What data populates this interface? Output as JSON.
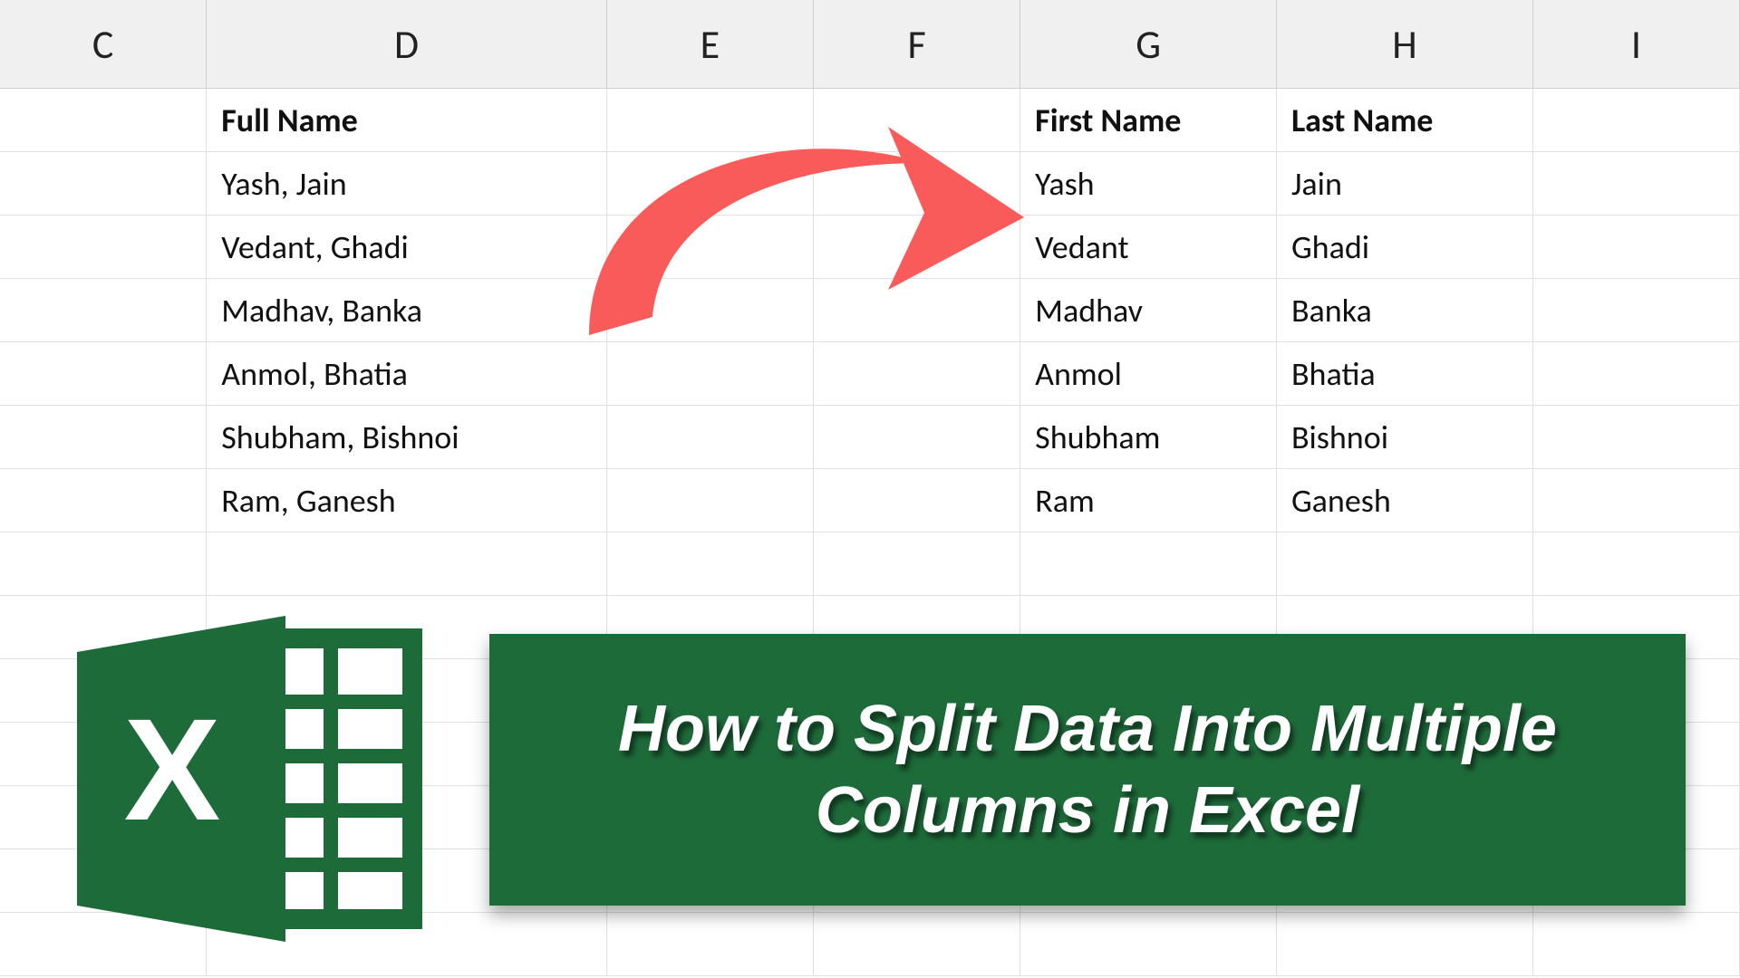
{
  "columns": [
    "C",
    "D",
    "E",
    "F",
    "G",
    "H",
    "I"
  ],
  "headers": {
    "fullName": "Full Name",
    "firstName": "First Name",
    "lastName": "Last Name"
  },
  "data": {
    "fullNames": [
      "Yash, Jain",
      "Vedant, Ghadi",
      "Madhav, Banka",
      "Anmol, Bhatia",
      "Shubham, Bishnoi",
      "Ram, Ganesh"
    ],
    "firstNames": [
      "Yash",
      "Vedant",
      "Madhav",
      "Anmol",
      "Shubham",
      "Ram"
    ],
    "lastNames": [
      "Jain",
      "Ghadi",
      "Banka",
      "Bhatia",
      "Bishnoi",
      "Ganesh"
    ]
  },
  "banner": {
    "title": "How to Split Data Into Multiple Columns in Excel"
  },
  "logo": {
    "letter": "X"
  },
  "colors": {
    "bannerBg": "#1e6b3a",
    "arrow": "#f95b5b",
    "excelGreen": "#1e6b3a"
  }
}
